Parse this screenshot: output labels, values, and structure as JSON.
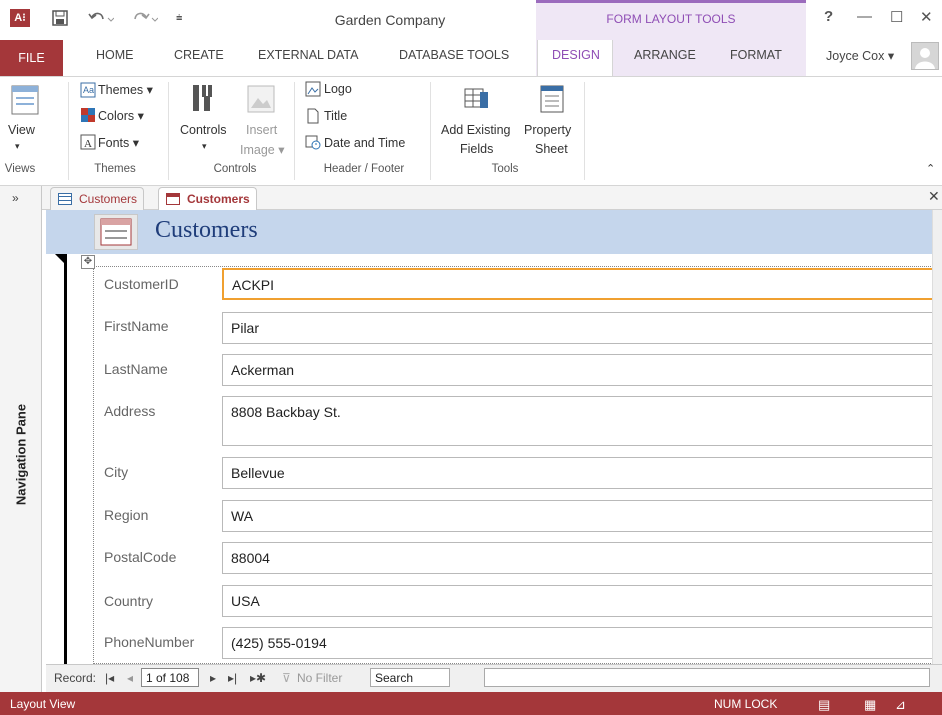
{
  "window": {
    "title": "Garden Company",
    "context_group": "FORM LAYOUT TOOLS",
    "help": "?",
    "minimize": "—",
    "maximize": "☐",
    "close": "✕",
    "app_icon": "A⁝"
  },
  "quick_access": {
    "save_icon": "save-icon",
    "undo_icon": "undo-icon",
    "redo_icon": "redo-icon"
  },
  "tabs": {
    "file": "FILE",
    "home": "HOME",
    "create": "CREATE",
    "external_data": "EXTERNAL DATA",
    "database_tools": "DATABASE TOOLS",
    "design": "DESIGN",
    "arrange": "ARRANGE",
    "format": "FORMAT"
  },
  "user": {
    "name": "Joyce Cox ▾"
  },
  "ribbon": {
    "views": {
      "label": "Views",
      "view": "View"
    },
    "themes": {
      "label": "Themes",
      "themes": "Themes ▾",
      "colors": "Colors ▾",
      "fonts": "Fonts ▾"
    },
    "controls": {
      "label": "Controls",
      "controls": "Controls",
      "insert_image_1": "Insert",
      "insert_image_2": "Image ▾"
    },
    "header_footer": {
      "label": "Header / Footer",
      "logo": "Logo",
      "title": "Title",
      "date_time": "Date and Time"
    },
    "tools": {
      "label": "Tools",
      "add_fields_1": "Add Existing",
      "add_fields_2": "Fields",
      "property_1": "Property",
      "property_2": "Sheet"
    }
  },
  "document_tabs": [
    {
      "label": "Customers"
    },
    {
      "label": "Customers"
    }
  ],
  "navigation_pane": {
    "label": "Navigation Pane",
    "toggle": "»"
  },
  "form": {
    "title": "Customers",
    "fields": [
      {
        "label": "CustomerID",
        "value": "ACKPI"
      },
      {
        "label": "FirstName",
        "value": "Pilar"
      },
      {
        "label": "LastName",
        "value": "Ackerman"
      },
      {
        "label": "Address",
        "value": "8808 Backbay St."
      },
      {
        "label": "City",
        "value": "Bellevue"
      },
      {
        "label": "Region",
        "value": "WA"
      },
      {
        "label": "PostalCode",
        "value": "88004"
      },
      {
        "label": "Country",
        "value": "USA"
      },
      {
        "label": "PhoneNumber",
        "value": "(425) 555-0194"
      }
    ]
  },
  "record_nav": {
    "label": "Record:",
    "first": "|◂",
    "prev": "◂",
    "position": "1 of 108",
    "next": "▸",
    "last": "▸|",
    "new": "▸✱",
    "filter": "No Filter",
    "search": "Search"
  },
  "status": {
    "view": "Layout View",
    "num_lock": "NUM LOCK"
  },
  "colors": {
    "accent": "#a4373a",
    "context": "#8f4eb5",
    "form_header": "#c5d6ec",
    "focus": "#f0a030"
  }
}
